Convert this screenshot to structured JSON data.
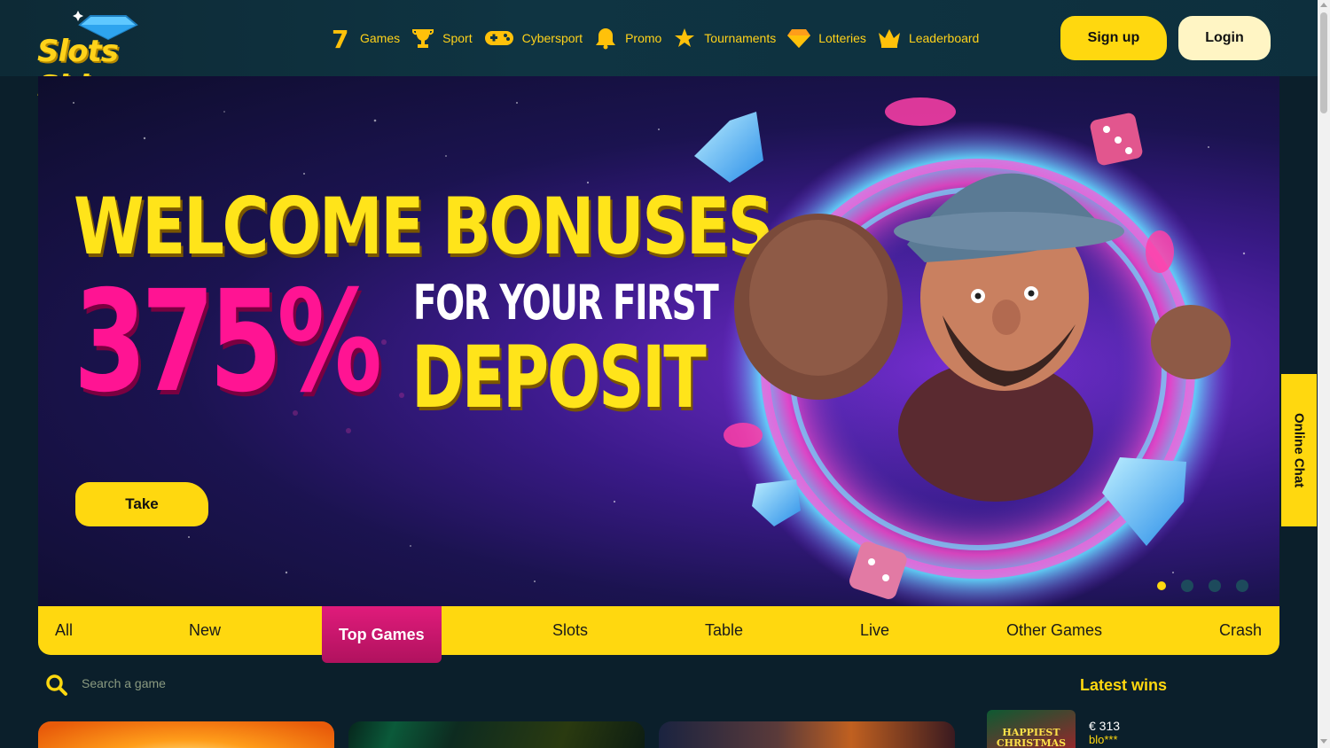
{
  "header": {
    "logo_text": "Slots Shine",
    "nav": [
      {
        "label": "Games",
        "icon": "seven-icon"
      },
      {
        "label": "Sport",
        "icon": "trophy-icon"
      },
      {
        "label": "Cybersport",
        "icon": "gamepad-icon"
      },
      {
        "label": "Promo",
        "icon": "bell-icon"
      },
      {
        "label": "Tournaments",
        "icon": "star-icon"
      },
      {
        "label": "Lotteries",
        "icon": "diamond-icon"
      },
      {
        "label": "Leaderboard",
        "icon": "crown-icon"
      }
    ],
    "signup_label": "Sign up",
    "login_label": "Login"
  },
  "banner": {
    "line1": "WELCOME BONUSES",
    "percent": "375%",
    "line2": "FOR YOUR FIRST",
    "line3": "DEPOSIT",
    "cta_label": "Take",
    "slides_total": 4,
    "slide_active": 1
  },
  "online_chat_label": "Online Chat",
  "categories": {
    "tabs": [
      "All",
      "New",
      "Top Games",
      "Slots",
      "Table",
      "Live",
      "Other Games",
      "Crash"
    ],
    "active": "Top Games"
  },
  "search": {
    "placeholder": "Search a game"
  },
  "latest_wins": {
    "title": "Latest wins",
    "items": [
      {
        "thumb_text": "HAPPIEST CHRISTMAS TREE",
        "amount": "€ 313",
        "user": "blo***"
      }
    ]
  },
  "colors": {
    "accent_yellow": "#ffd80f",
    "active_tab": "#e01b7b",
    "header_bg": "#0f3442",
    "page_bg": "#0b1f2b"
  }
}
